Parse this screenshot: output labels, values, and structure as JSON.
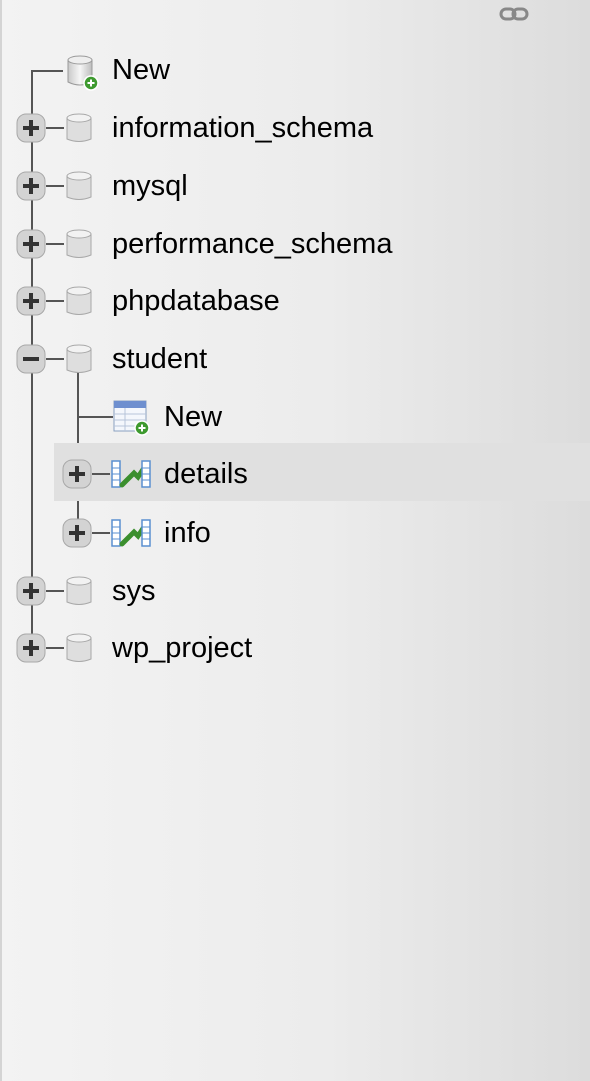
{
  "navigation_tree": {
    "top_new_label": "New",
    "databases": [
      {
        "name": "information_schema",
        "expanded": false
      },
      {
        "name": "mysql",
        "expanded": false
      },
      {
        "name": "performance_schema",
        "expanded": false
      },
      {
        "name": "phpdatabase",
        "expanded": false
      },
      {
        "name": "student",
        "expanded": true,
        "children": [
          {
            "name": "New",
            "icon": "new-table-icon"
          },
          {
            "name": "details",
            "icon": "table-icon",
            "selected": true
          },
          {
            "name": "info",
            "icon": "table-icon"
          }
        ]
      },
      {
        "name": "sys",
        "expanded": false
      },
      {
        "name": "wp_project",
        "expanded": false
      }
    ]
  },
  "icons": {
    "link": "link-icon",
    "database": "database-icon",
    "new": "new-database-icon",
    "expand": "plus-icon",
    "collapse": "minus-icon"
  },
  "colors": {
    "tree_line": "#555555",
    "selected_row": "#e0e0e0",
    "new_badge": "#3e9a2f",
    "table_accent": "#3b8f2e"
  }
}
